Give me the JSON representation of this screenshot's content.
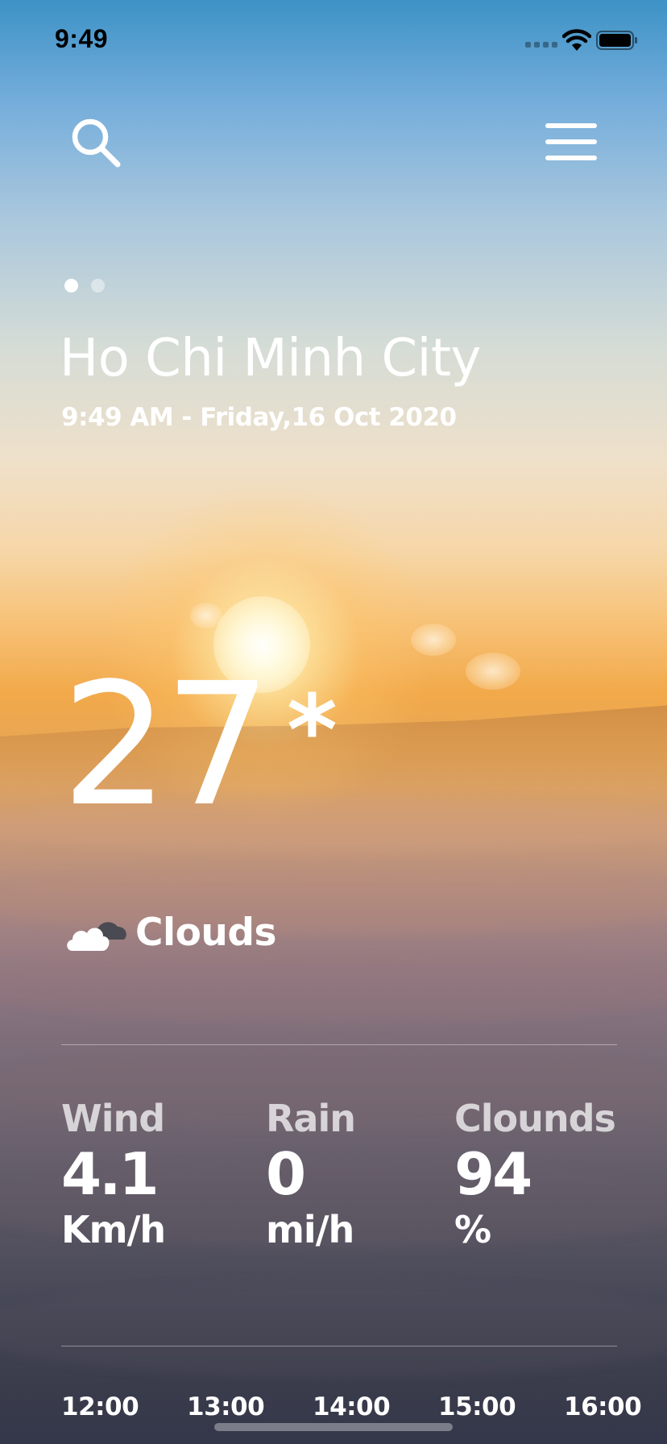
{
  "status_bar": {
    "time": "9:49",
    "icons": [
      "cellular-signal-icon",
      "wifi-icon",
      "battery-icon"
    ]
  },
  "header": {
    "search_icon": "search-icon",
    "menu_icon": "hamburger-menu-icon"
  },
  "pager": {
    "total_pages": 2,
    "active_index": 0
  },
  "location": {
    "city": "Ho Chi Minh City",
    "datetime": "9:49 AM - Friday,16 Oct 2020"
  },
  "current": {
    "temperature": "27",
    "unit_symbol": "*",
    "condition_icon": "cloud-icon",
    "condition": "Clouds"
  },
  "stats": [
    {
      "label": "Wind",
      "value": "4.1",
      "unit": "Km/h"
    },
    {
      "label": "Rain",
      "value": "0",
      "unit": "mi/h"
    },
    {
      "label": "Clounds",
      "value": "94",
      "unit": "%"
    }
  ],
  "hourly": [
    "12:00",
    "13:00",
    "14:00",
    "15:00",
    "16:00"
  ],
  "colors": {
    "text": "#ffffff",
    "sky_top": "#3d92c6",
    "sun": "#f7c278",
    "clouds_bottom": "#33374a"
  }
}
